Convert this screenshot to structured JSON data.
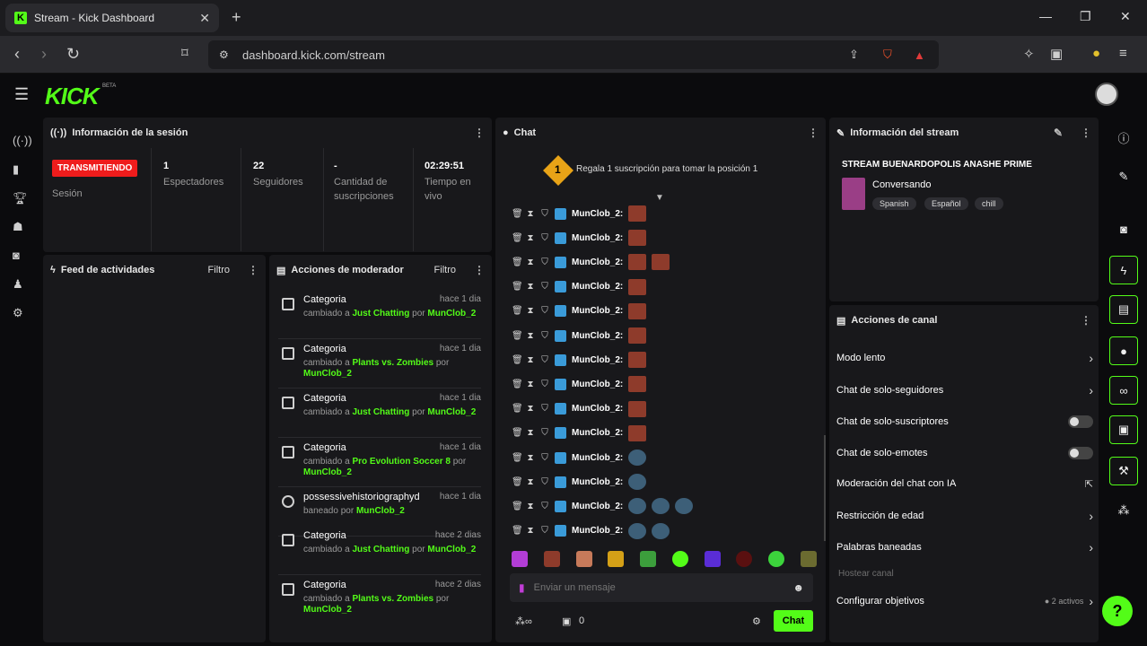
{
  "browser": {
    "tab_title": "Stream - Kick Dashboard",
    "url": "dashboard.kick.com/stream"
  },
  "app": {
    "logo": "KICK",
    "beta": "BETA"
  },
  "session": {
    "title": "Información de la sesión",
    "live_badge": "TRANSMITIENDO",
    "session_label": "Sesión",
    "stats": [
      {
        "value": "1",
        "label": "Espectadores"
      },
      {
        "value": "22",
        "label": "Seguidores"
      },
      {
        "value": "-",
        "label": "Cantidad de suscripciones"
      },
      {
        "value": "02:29:51",
        "label": "Tiempo en vivo"
      }
    ]
  },
  "feed": {
    "title": "Feed de actividades",
    "filter": "Filtro"
  },
  "mod": {
    "title": "Acciones de moderador",
    "filter": "Filtro",
    "items": [
      {
        "title": "Categoria",
        "pre": "cambiado a ",
        "target": "Just Chatting",
        "mid": " por ",
        "user": "MunClob_2",
        "time": "hace 1 dia"
      },
      {
        "title": "Categoria",
        "pre": "cambiado a ",
        "target": "Plants vs. Zombies",
        "mid": " por ",
        "user": "MunClob_2",
        "time": "hace 1 dia"
      },
      {
        "title": "Categoria",
        "pre": "cambiado a ",
        "target": "Just Chatting",
        "mid": " por ",
        "user": "MunClob_2",
        "time": "hace 1 dia"
      },
      {
        "title": "Categoria",
        "pre": "cambiado a ",
        "target": "Pro Evolution Soccer 8",
        "mid": " por ",
        "user": "MunClob_2",
        "time": "hace 1 dia"
      },
      {
        "title": "possessivehistoriographyd",
        "pre": "baneado por ",
        "target": "MunClob_2",
        "mid": "",
        "user": "",
        "time": "hace 1 dia"
      },
      {
        "title": "Categoria",
        "pre": "cambiado a ",
        "target": "Just Chatting",
        "mid": " por ",
        "user": "MunClob_2",
        "time": "hace 2 dias"
      },
      {
        "title": "Categoria",
        "pre": "cambiado a ",
        "target": "Plants vs. Zombies",
        "mid": " por ",
        "user": "MunClob_2",
        "time": "hace 2 dias"
      }
    ]
  },
  "chat": {
    "title": "Chat",
    "pin_number": "1",
    "pin_text": "Regala 1 suscripción para tomar la posición 1",
    "username": "MunClob_2:",
    "placeholder": "Enviar un mensaje",
    "points": "0",
    "send": "Chat"
  },
  "stream_info": {
    "title": "Información del stream",
    "stream_title": "STREAM BUENARDOPOLIS ANASHE PRIME",
    "category": "Conversando",
    "tags": [
      "Spanish",
      "Español",
      "chill"
    ]
  },
  "channel_actions": {
    "title": "Acciones de canal",
    "items": [
      {
        "label": "Modo lento",
        "control": "chevron"
      },
      {
        "label": "Chat de solo-seguidores",
        "control": "chevron"
      },
      {
        "label": "Chat de solo-suscriptores",
        "control": "toggle"
      },
      {
        "label": "Chat de solo-emotes",
        "control": "toggle"
      },
      {
        "label": "Moderación del chat con IA",
        "control": "external"
      },
      {
        "label": "Restricción de edad",
        "control": "chevron"
      },
      {
        "label": "Palabras baneadas",
        "control": "chevron"
      }
    ],
    "host_label": "Hostear canal",
    "goals_label": "Configurar objetivos",
    "goals_active": "● 2 activos"
  },
  "colors": {
    "accent": "#53fc18",
    "live": "#ef1c1c"
  }
}
